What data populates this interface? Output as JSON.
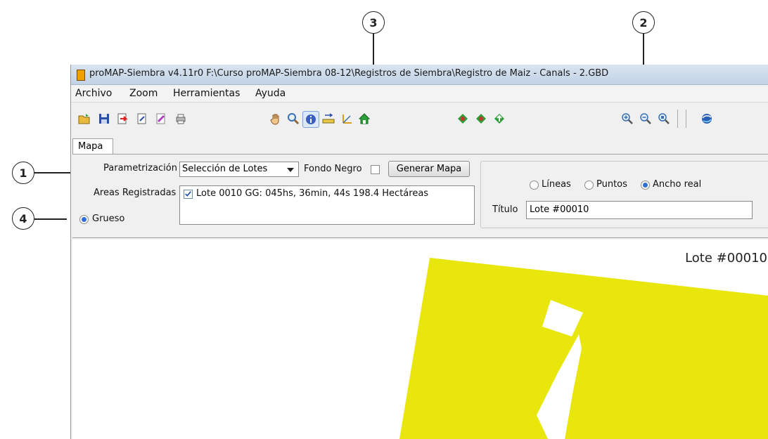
{
  "window": {
    "title": "proMAP-Siembra v4.11r0    F:\\Curso proMAP-Siembra 08-12\\Registros de Siembra\\Registro de Maiz - Canals - 2.GBD"
  },
  "menu": {
    "items": [
      "Archivo",
      "Zoom",
      "Herramientas",
      "Ayuda"
    ]
  },
  "toolbar": {
    "icons": [
      "open-folder-icon",
      "save-icon",
      "export-icon",
      "edit-icon",
      "paint-icon",
      "print-icon",
      "hand-pan-icon",
      "zoom-search-icon",
      "info-icon",
      "measure-icon",
      "axis-icon",
      "home-icon",
      "marker-icon",
      "marker-icon",
      "marker-up-icon",
      "zoom-in-icon",
      "zoom-out-icon",
      "zoom-extent-icon",
      "google-earth-icon"
    ]
  },
  "tabs": [
    "Mapa"
  ],
  "panel": {
    "param_label": "Parametrización",
    "param_select_value": "Selección de Lotes",
    "fondo_negro_label": "Fondo Negro",
    "fondo_negro_checked": false,
    "generar_button": "Generar Mapa",
    "areas_label": "Areas Registradas",
    "areas_item": "Lote 0010 GG: 045hs, 36min, 44s 198.4 Hectáreas",
    "areas_item_checked": true,
    "grueso_label": "Grueso",
    "grueso_selected": true,
    "radios": [
      {
        "label": "Líneas",
        "selected": false
      },
      {
        "label": "Puntos",
        "selected": false
      },
      {
        "label": "Ancho real",
        "selected": true
      }
    ],
    "titulo_label": "Título",
    "titulo_value": "Lote #00010"
  },
  "map": {
    "title": "Lote #00010",
    "fill_color": "#e8e60a"
  },
  "callouts": [
    "1",
    "2",
    "3",
    "4"
  ]
}
